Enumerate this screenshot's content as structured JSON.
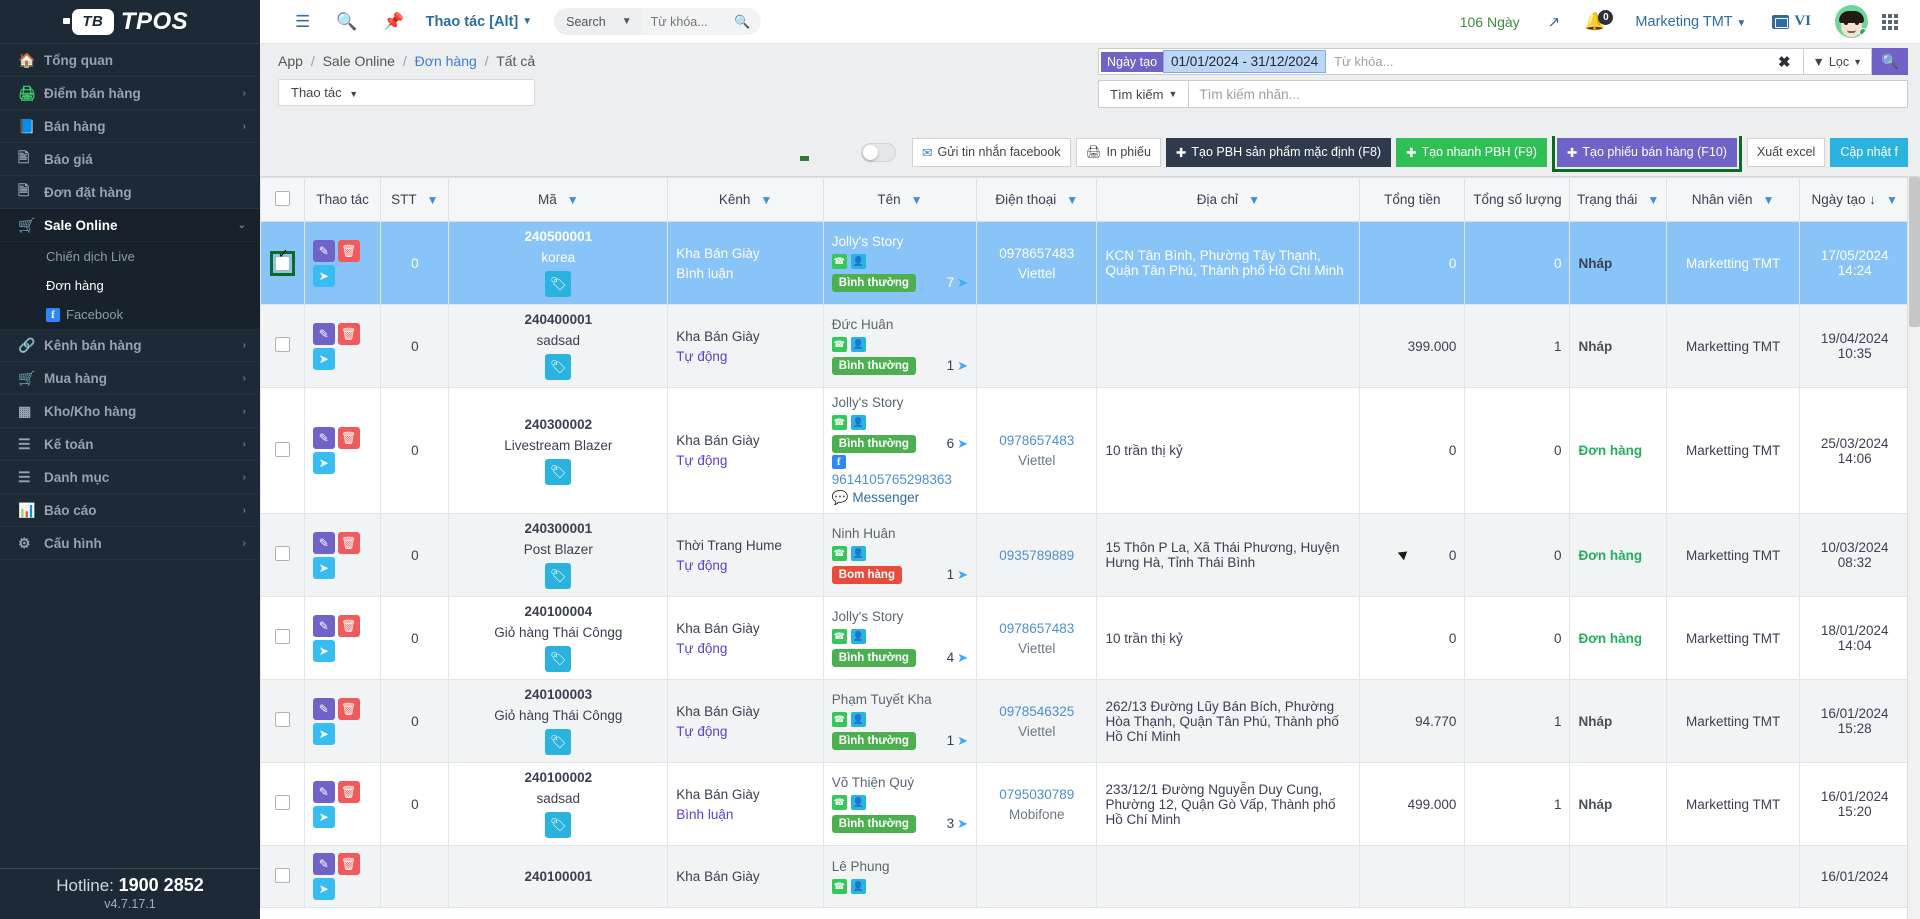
{
  "brand": {
    "name": "TPOS",
    "mark": "TB"
  },
  "sidebar": {
    "items": [
      {
        "label": "Tổng quan",
        "icon": "home-icon",
        "caret": "",
        "active": false
      },
      {
        "label": "Điểm bán hàng",
        "icon": "printer-icon",
        "caret": "›",
        "active": false
      },
      {
        "label": "Bán hàng",
        "icon": "book-icon",
        "caret": "›",
        "active": false
      },
      {
        "label": "Báo giá",
        "icon": "quote-icon",
        "caret": "",
        "active": false
      },
      {
        "label": "Đơn đặt hàng",
        "icon": "orders-icon",
        "caret": "",
        "active": false
      },
      {
        "label": "Sale Online",
        "icon": "cart-flag-icon",
        "caret": "⌄",
        "active": true
      },
      {
        "label": "Kênh bán hàng",
        "icon": "link-icon",
        "caret": "›",
        "active": false
      },
      {
        "label": "Mua hàng",
        "icon": "shopping-cart-icon",
        "caret": "›",
        "active": false
      },
      {
        "label": "Kho/Kho hàng",
        "icon": "grid-icon",
        "caret": "›",
        "active": false
      },
      {
        "label": "Kế toán",
        "icon": "list-icon",
        "caret": "›",
        "active": false
      },
      {
        "label": "Danh mục",
        "icon": "list-icon",
        "caret": "›",
        "active": false
      },
      {
        "label": "Báo cáo",
        "icon": "chart-icon",
        "caret": "›",
        "active": false
      },
      {
        "label": "Cấu hình",
        "icon": "gear-icon",
        "caret": "›",
        "active": false
      }
    ],
    "sub_items": [
      {
        "label": "Chiến dịch Live",
        "current": false,
        "icon": ""
      },
      {
        "label": "Đơn hàng",
        "current": true,
        "icon": ""
      },
      {
        "label": "Facebook",
        "current": false,
        "icon": "facebook-icon"
      }
    ],
    "footer": {
      "hotline_label": "Hotline:",
      "hotline_number": "1900 2852",
      "version": "v4.7.17.1"
    }
  },
  "topbar": {
    "collapse_icon": "sidebar-collapse-icon",
    "search_icon": "search-icon",
    "pin_icon": "pin-icon",
    "action_menu": "Thao tác [Alt]",
    "search_scope": "Search",
    "search_placeholder": "Từ khóa...",
    "search_value": "",
    "days_left": "106 Ngày",
    "expand_icon": "expand-icon",
    "notification_count": "0",
    "user_menu": "Marketing TMT",
    "language": "VI",
    "apps_icon": "apps-grid-icon"
  },
  "breadcrumb": {
    "items": [
      "App",
      "Sale Online",
      "Đơn hàng",
      "Tất cả"
    ],
    "link_index": 2
  },
  "page_actions": {
    "thao_tac": "Thao tác"
  },
  "filter": {
    "date_pill": "Ngày tạo",
    "date_range": "01/01/2024 - 31/12/2024",
    "keyword_placeholder": "Từ khóa...",
    "clear_label": "✖",
    "loc_label": "Lọc",
    "search_btn_icon": "search-icon",
    "tim_kiem_label": "Tìm kiếm",
    "tag_placeholder": "Tìm kiếm nhãn..."
  },
  "toolbar": {
    "toggle_on": false,
    "buttons": [
      {
        "label": "Gửi tin nhắn facebook",
        "icon": "envelope-icon",
        "style": "white",
        "highlighted": false
      },
      {
        "label": "In phiếu",
        "icon": "printer-icon",
        "style": "white",
        "highlighted": false
      },
      {
        "label": "Tạo PBH sản phẩm mặc định (F8)",
        "icon": "plus-circle-icon",
        "style": "dark",
        "highlighted": false
      },
      {
        "label": "Tạo nhanh PBH (F9)",
        "icon": "plus-circle-icon",
        "style": "green",
        "highlighted": false
      },
      {
        "label": "Tạo phiếu bán hàng (F10)",
        "icon": "plus-circle-icon",
        "style": "purple",
        "highlighted": true
      },
      {
        "label": "Xuất excel",
        "icon": "",
        "style": "white",
        "highlighted": false
      },
      {
        "label": "Cập nhật f",
        "icon": "",
        "style": "cyan",
        "highlighted": false
      }
    ]
  },
  "table": {
    "columns": [
      {
        "label": "",
        "filter": false
      },
      {
        "label": "Thao tác",
        "filter": false
      },
      {
        "label": "STT",
        "filter": true
      },
      {
        "label": "Mã",
        "filter": true
      },
      {
        "label": "Kênh",
        "filter": true
      },
      {
        "label": "Tên",
        "filter": true
      },
      {
        "label": "Điện thoại",
        "filter": true
      },
      {
        "label": "Địa chỉ",
        "filter": true
      },
      {
        "label": "Tổng tiền",
        "filter": false
      },
      {
        "label": "Tổng số lượng",
        "filter": false
      },
      {
        "label": "Trạng thái",
        "filter": true
      },
      {
        "label": "Nhân viên",
        "filter": true
      },
      {
        "label": "Ngày tạo ↓",
        "filter": true
      }
    ],
    "rows": [
      {
        "selected": true,
        "stt": "0",
        "code": "240500001",
        "sub": "korea",
        "kenh": "Kha Bán Giày",
        "kenh_sub": "Bình luận",
        "ten": "Jolly's Story",
        "badge": "Bình thường",
        "badge_type": "green",
        "send_count": "7",
        "fb_psid": "",
        "messenger": "",
        "phone": "0978657483",
        "carrier": "Viettel",
        "address": "KCN Tân Bình, Phường Tây Thạnh, Quận Tân Phú, Thành phố Hồ Chí Minh",
        "tong_tien": "0",
        "tong_sl": "0",
        "trang_thai": "Nháp",
        "trang_thai_type": "nhap",
        "nhan_vien": "Marketting TMT",
        "ngay": "17/05/2024",
        "gio": "14:24"
      },
      {
        "selected": false,
        "stt": "0",
        "code": "240400001",
        "sub": "sadsad",
        "kenh": "Kha Bán Giày",
        "kenh_sub": "Tự động",
        "ten": "Đức Huân",
        "badge": "Bình thường",
        "badge_type": "green",
        "send_count": "1",
        "fb_psid": "",
        "messenger": "",
        "phone": "",
        "carrier": "",
        "address": "",
        "tong_tien": "399.000",
        "tong_sl": "1",
        "trang_thai": "Nháp",
        "trang_thai_type": "nhap",
        "nhan_vien": "Marketting TMT",
        "ngay": "19/04/2024",
        "gio": "10:35"
      },
      {
        "selected": false,
        "stt": "0",
        "code": "240300002",
        "sub": "Livestream Blazer",
        "kenh": "Kha Bán Giày",
        "kenh_sub": "Tự động",
        "ten": "Jolly's Story",
        "badge": "Bình thường",
        "badge_type": "green",
        "send_count": "6",
        "fb_psid": "9614105765298363",
        "messenger": "Messenger",
        "phone": "0978657483",
        "carrier": "Viettel",
        "address": "10 trần thị kỷ",
        "tong_tien": "0",
        "tong_sl": "0",
        "trang_thai": "Đơn hàng",
        "trang_thai_type": "don",
        "nhan_vien": "Marketting TMT",
        "ngay": "25/03/2024",
        "gio": "14:06"
      },
      {
        "selected": false,
        "stt": "0",
        "code": "240300001",
        "sub": "Post Blazer",
        "kenh": "Thời Trang Hume",
        "kenh_sub": "Tự động",
        "ten": "Ninh Huân",
        "badge": "Bom hàng",
        "badge_type": "red",
        "send_count": "1",
        "fb_psid": "",
        "messenger": "",
        "phone": "0935789889",
        "carrier": "",
        "address": "15 Thôn P La, Xã Thái Phương, Huyện Hưng Hà, Tỉnh Thái Bình",
        "tong_tien": "0",
        "tong_sl": "0",
        "trang_thai": "Đơn hàng",
        "trang_thai_type": "don",
        "nhan_vien": "Marketting TMT",
        "ngay": "10/03/2024",
        "gio": "08:32"
      },
      {
        "selected": false,
        "stt": "0",
        "code": "240100004",
        "sub": "Giỏ hàng Thái Côngg",
        "kenh": "Kha Bán Giày",
        "kenh_sub": "Tự động",
        "ten": "Jolly's Story",
        "badge": "Bình thường",
        "badge_type": "green",
        "send_count": "4",
        "fb_psid": "",
        "messenger": "",
        "phone": "0978657483",
        "carrier": "Viettel",
        "address": "10 trần thị kỷ",
        "tong_tien": "0",
        "tong_sl": "0",
        "trang_thai": "Đơn hàng",
        "trang_thai_type": "don",
        "nhan_vien": "Marketting TMT",
        "ngay": "18/01/2024",
        "gio": "14:04"
      },
      {
        "selected": false,
        "stt": "0",
        "code": "240100003",
        "sub": "Giỏ hàng Thái Côngg",
        "kenh": "Kha Bán Giày",
        "kenh_sub": "Tự động",
        "ten": "Phạm Tuyết Kha",
        "badge": "Bình thường",
        "badge_type": "green",
        "send_count": "1",
        "fb_psid": "",
        "messenger": "",
        "phone": "0978546325",
        "carrier": "Viettel",
        "address": "262/13 Đường Lũy Bán Bích, Phường Hòa Thạnh, Quận Tân Phú, Thành phố Hồ Chí Minh",
        "tong_tien": "94.770",
        "tong_sl": "1",
        "trang_thai": "Nháp",
        "trang_thai_type": "nhap",
        "nhan_vien": "Marketting TMT",
        "ngay": "16/01/2024",
        "gio": "15:28"
      },
      {
        "selected": false,
        "stt": "0",
        "code": "240100002",
        "sub": "sadsad",
        "kenh": "Kha Bán Giày",
        "kenh_sub": "Bình luận",
        "ten": "Võ Thiện Quý",
        "badge": "Bình thường",
        "badge_type": "green",
        "send_count": "3",
        "fb_psid": "",
        "messenger": "",
        "phone": "0795030789",
        "carrier": "Mobifone",
        "address": "233/12/1 Đường Nguyễn Duy Cung, Phường 12, Quận Gò Vấp, Thành phố Hồ Chí Minh",
        "tong_tien": "499.000",
        "tong_sl": "1",
        "trang_thai": "Nháp",
        "trang_thai_type": "nhap",
        "nhan_vien": "Marketting TMT",
        "ngay": "16/01/2024",
        "gio": "15:20"
      },
      {
        "selected": false,
        "stt": "",
        "code": "240100001",
        "sub": "",
        "kenh": "Kha Bán Giày",
        "kenh_sub": "",
        "ten": "Lê Phung",
        "badge": "",
        "badge_type": "",
        "send_count": "",
        "fb_psid": "",
        "messenger": "",
        "phone": "",
        "carrier": "",
        "address": "",
        "tong_tien": "",
        "tong_sl": "",
        "trang_thai": "",
        "trang_thai_type": "",
        "nhan_vien": "",
        "ngay": "16/01/2024",
        "gio": ""
      }
    ]
  }
}
